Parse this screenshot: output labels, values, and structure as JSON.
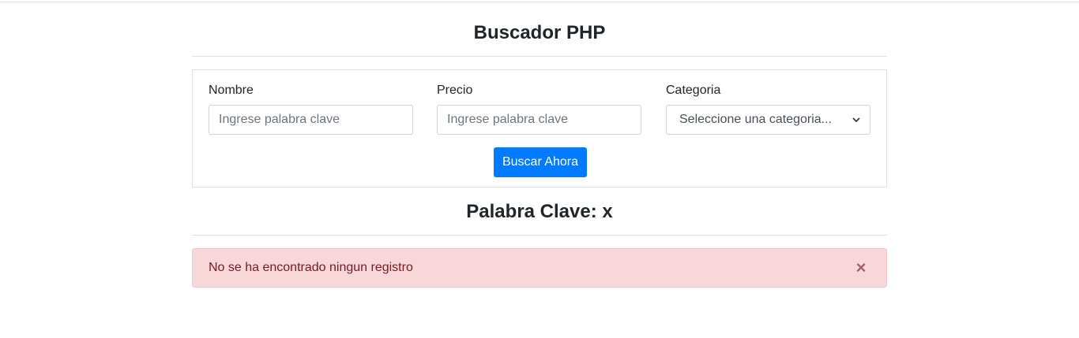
{
  "header": {
    "title": "Buscador PHP"
  },
  "form": {
    "nombre": {
      "label": "Nombre",
      "placeholder": "Ingrese palabra clave",
      "value": ""
    },
    "precio": {
      "label": "Precio",
      "placeholder": "Ingrese palabra clave",
      "value": ""
    },
    "categoria": {
      "label": "Categoria",
      "selected": "Seleccione una categoria..."
    },
    "submit_label": "Buscar Ahora"
  },
  "results": {
    "heading": "Palabra Clave: x",
    "alert_message": "No se ha encontrado ningun registro",
    "close_glyph": "×"
  },
  "colors": {
    "primary": "#007bff",
    "alert_bg": "#f8d7da",
    "alert_text": "#721c24"
  }
}
